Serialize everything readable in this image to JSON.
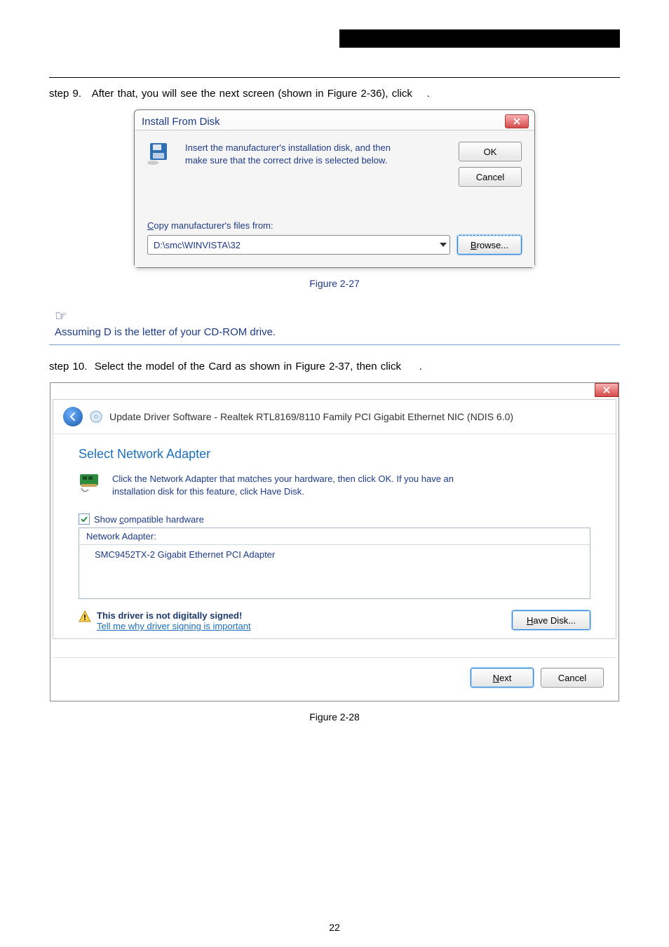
{
  "header_black_bar": "",
  "step9": {
    "label": "step 9.",
    "text_before": "After that, you will see the next screen (shown in Figure 2-36), click",
    "text_after": "."
  },
  "install_dialog": {
    "title": "Install From Disk",
    "message_line1": "Insert the manufacturer's installation disk, and then",
    "message_line2": "make sure that the correct drive is selected below.",
    "ok": "OK",
    "cancel": "Cancel",
    "copy_label": "Copy manufacturer's files from:",
    "path_value": "D:\\smc\\WINVISTA\\32",
    "browse": "Browse..."
  },
  "fig27": "Figure 2-27",
  "note_icon": "☞",
  "note": "Assuming D is the letter of your CD-ROM drive.",
  "step10": {
    "label": "step 10.",
    "text_before": "Select the model of the Card as shown in Figure 2-37, then click",
    "text_after": "."
  },
  "update_dialog": {
    "title": "Update Driver Software - Realtek RTL8169/8110 Family PCI Gigabit Ethernet NIC (NDIS 6.0)",
    "heading": "Select Network Adapter",
    "msg_line1": "Click the Network Adapter that matches your hardware, then click OK. If you have an",
    "msg_line2": "installation disk for this feature, click Have Disk.",
    "show_compatible": "Show compatible hardware",
    "list_header": "Network Adapter:",
    "list_item": "SMC9452TX-2 Gigabit Ethernet PCI Adapter",
    "signed_title": "This driver is not digitally signed!",
    "signed_link": "Tell me why driver signing is important",
    "have_disk": "Have Disk...",
    "next": "Next",
    "cancel": "Cancel"
  },
  "fig28": "Figure 2-28",
  "page_number": "22"
}
